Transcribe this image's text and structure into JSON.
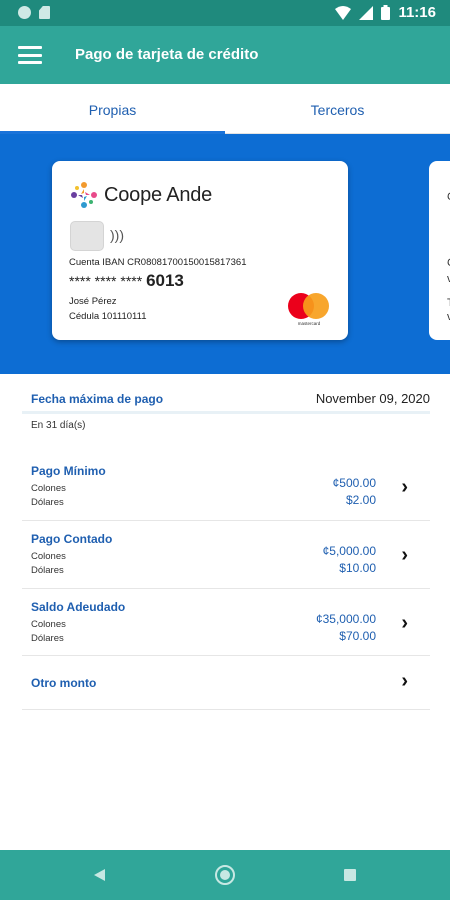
{
  "status_bar": {
    "time": "11:16"
  },
  "app_bar": {
    "title": "Pago de tarjeta de crédito"
  },
  "tabs": [
    {
      "label": "Propias",
      "active": true
    },
    {
      "label": "Terceros",
      "active": false
    }
  ],
  "card": {
    "brand": "Coope Ande",
    "iban": "Cuenta IBAN CR08081700150015817361",
    "masked_number": "**** **** ****",
    "last4": "6013",
    "holder": "José Pérez",
    "cedula": "Cédula  101110111",
    "network": "mastercard"
  },
  "next_card_glyphs": [
    "C",
    "C",
    "v",
    "T",
    "v"
  ],
  "due": {
    "label": "Fecha máxima de pago",
    "date": "November 09, 2020",
    "days_left": "En 31 día(s)"
  },
  "options": [
    {
      "name": "Pago Mínimo",
      "sub1": "Colones",
      "sub2": "Dólares",
      "amount1": "¢500.00",
      "amount2": "$2.00"
    },
    {
      "name": "Pago Contado",
      "sub1": "Colones",
      "sub2": "Dólares",
      "amount1": "¢5,000.00",
      "amount2": "$10.00"
    },
    {
      "name": "Saldo Adeudado",
      "sub1": "Colones",
      "sub2": "Dólares",
      "amount1": "¢35,000.00",
      "amount2": "$70.00"
    }
  ],
  "other_amount": {
    "label": "Otro monto"
  },
  "colors": {
    "status_bar": "#1f8a7d",
    "app_bar": "#30a699",
    "banner": "#0d6dd3",
    "link_blue": "#1f5fb0"
  }
}
